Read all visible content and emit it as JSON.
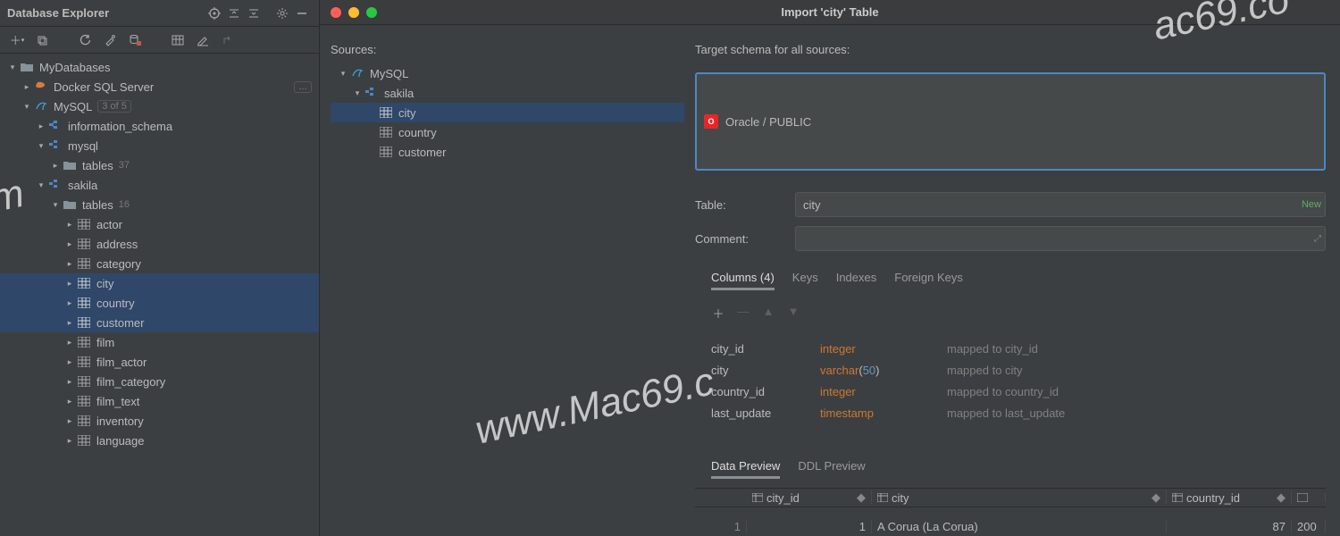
{
  "explorer": {
    "title": "Database Explorer",
    "tree": {
      "root": "MyDatabases",
      "docker": "Docker SQL Server",
      "mysql": "MySQL",
      "mysql_count": "3 of 5",
      "info_schema": "information_schema",
      "mysql_db": "mysql",
      "mysql_tables": "tables",
      "mysql_tables_count": "37",
      "sakila": "sakila",
      "sakila_tables": "tables",
      "sakila_tables_count": "16",
      "t_actor": "actor",
      "t_address": "address",
      "t_category": "category",
      "t_city": "city",
      "t_country": "country",
      "t_customer": "customer",
      "t_film": "film",
      "t_film_actor": "film_actor",
      "t_film_category": "film_category",
      "t_film_text": "film_text",
      "t_inventory": "inventory",
      "t_language": "language"
    }
  },
  "dialog": {
    "title": "Import 'city' Table",
    "sources_label": "Sources:",
    "src_mysql": "MySQL",
    "src_sakila": "sakila",
    "src_city": "city",
    "src_country": "country",
    "src_customer": "customer",
    "target_label": "Target schema for all sources:",
    "target_schema": "Oracle / PUBLIC",
    "table_label": "Table:",
    "table_value": "city",
    "new_label": "New",
    "comment_label": "Comment:",
    "tabs": {
      "columns": "Columns (4)",
      "keys": "Keys",
      "indexes": "Indexes",
      "fkeys": "Foreign Keys"
    },
    "columns": [
      {
        "name": "city_id",
        "type": "integer",
        "map": "mapped to city_id"
      },
      {
        "name": "city",
        "type": "varchar",
        "arg": "50",
        "map": "mapped to city"
      },
      {
        "name": "country_id",
        "type": "integer",
        "map": "mapped to country_id"
      },
      {
        "name": "last_update",
        "type": "timestamp",
        "map": "mapped to last_update"
      }
    ],
    "tabs2": {
      "data": "Data Preview",
      "ddl": "DDL Preview"
    },
    "preview": {
      "headers": {
        "c1": "city_id",
        "c2": "city",
        "c3": "country_id"
      },
      "row": {
        "idx": "1",
        "c1": "1",
        "c2": "A Corua (La Corua)",
        "c3": "87",
        "c4": "200"
      }
    }
  },
  "watermarks": {
    "w1": "www.Mac69.c",
    "w2": "ac69.co",
    "w3": "m"
  }
}
